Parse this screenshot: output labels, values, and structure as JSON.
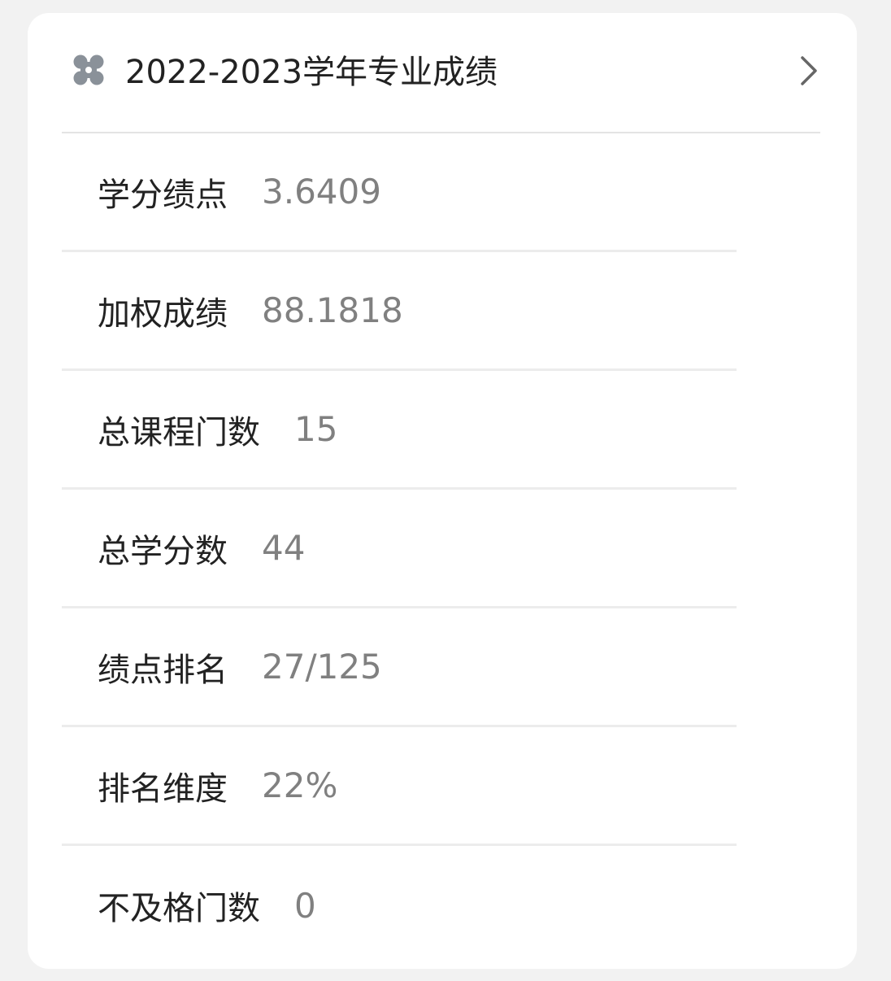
{
  "header": {
    "title": "2022-2023学年专业成绩",
    "icon": "grid-dots-icon",
    "chevron_icon": "chevron-right-icon"
  },
  "stats": [
    {
      "label": "学分绩点",
      "value": "3.6409"
    },
    {
      "label": "加权成绩",
      "value": "88.1818"
    },
    {
      "label": "总课程门数",
      "value": "15"
    },
    {
      "label": "总学分数",
      "value": "44"
    },
    {
      "label": "绩点排名",
      "value": "27/125"
    },
    {
      "label": "排名维度",
      "value": "22%"
    },
    {
      "label": "不及格门数",
      "value": "0"
    }
  ],
  "colors": {
    "icon": "#8a9199",
    "label": "#222222",
    "value": "#808080",
    "divider": "#ececec"
  }
}
